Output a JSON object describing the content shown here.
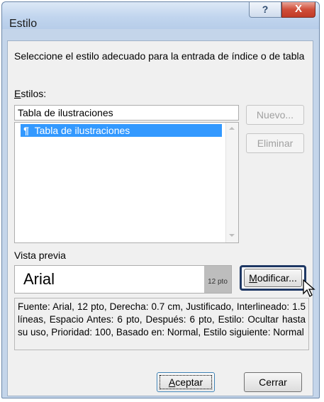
{
  "window": {
    "title": "Estilo",
    "help_label": "?",
    "close_label": "X"
  },
  "instructions": "Seleccione el estilo adecuado para la entrada de índice o de tabla",
  "styles": {
    "label_accel": "E",
    "label_rest": "stilos:",
    "current_value": "Tabla de ilustraciones",
    "items": [
      {
        "icon": "paragraph-style-icon",
        "symbol": "¶",
        "label": "Tabla de ilustraciones",
        "selected": true
      }
    ]
  },
  "buttons": {
    "new_label": "Nuevo...",
    "delete_label": "Eliminar",
    "modify_accel": "M",
    "modify_rest": "odificar...",
    "accept_accel": "A",
    "accept_rest": "ceptar",
    "close_label": "Cerrar"
  },
  "preview": {
    "label": "Vista previa",
    "font_name": "Arial",
    "size_label": "12 pto"
  },
  "description": "Fuente: Arial, 12 pto, Derecha: 0.7 cm, Justificado, Interlineado: 1.5 líneas, Espacio Antes: 6 pto, Después: 6 pto, Estilo: Ocultar hasta su uso, Prioridad: 100, Basado en: Normal, Estilo siguiente: Normal",
  "colors": {
    "selection": "#3399ff",
    "title_bar": "#c4d5ea",
    "close_button": "#c94430",
    "focus_frame": "#1f3864"
  }
}
